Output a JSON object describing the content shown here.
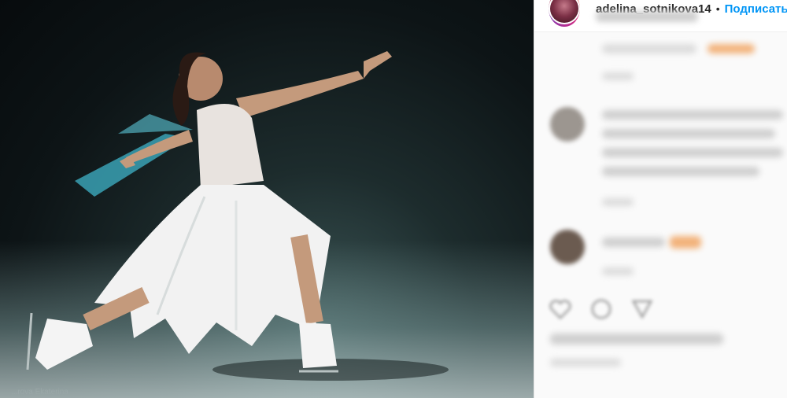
{
  "post": {
    "username": "adelina_sotnikova14",
    "separator": "•",
    "follow_label": "Подписаться",
    "photo_credit": "...rova Ekaterina"
  },
  "colors": {
    "accent": "#0095f6",
    "story_ring": "#dd2a7b",
    "photo_bg": "#0d1416"
  }
}
